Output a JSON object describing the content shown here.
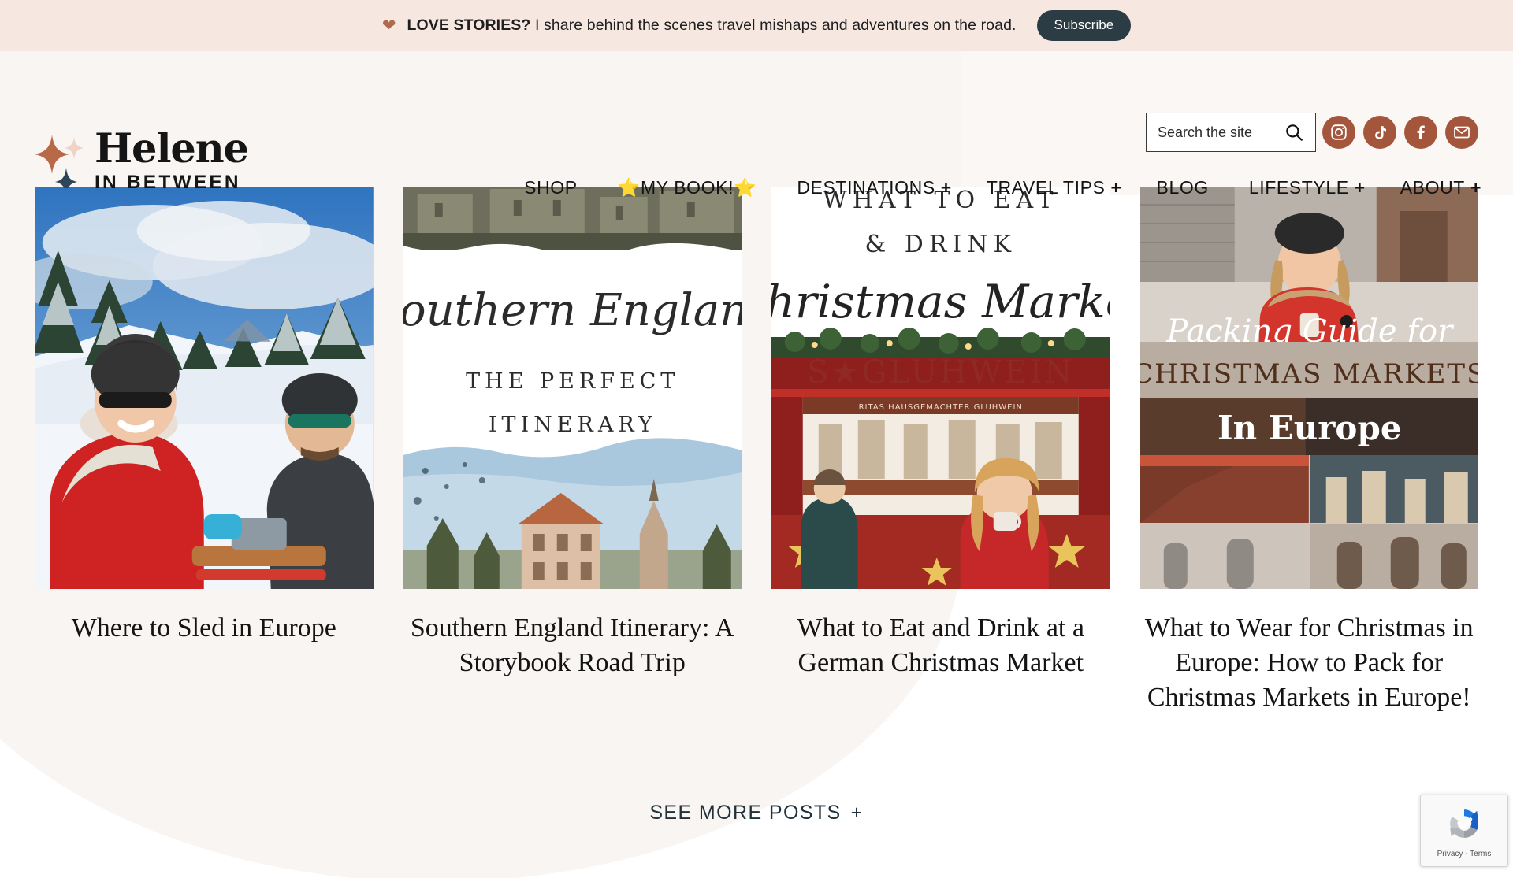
{
  "announcement": {
    "heart_icon": "heart-icon",
    "bold_text": "LOVE STORIES?",
    "rest_text": " I share behind the scenes travel mishaps and adventures on the road.",
    "subscribe_label": "Subscribe",
    "bg_color": "#f7e7e1",
    "button_color": "#2c3c44"
  },
  "header": {
    "logo": {
      "main": "Helene",
      "sub": "IN BETWEEN"
    },
    "search": {
      "placeholder": "Search the site",
      "value": "",
      "icon": "search-icon"
    },
    "socials": [
      {
        "name": "instagram-icon",
        "label": "Instagram"
      },
      {
        "name": "tiktok-icon",
        "label": "TikTok"
      },
      {
        "name": "facebook-icon",
        "label": "Facebook"
      },
      {
        "name": "email-icon",
        "label": "Email"
      }
    ],
    "social_color": "#a4563c",
    "nav": [
      {
        "label": "SHOP",
        "plus": ""
      },
      {
        "label": "⭐MY BOOK!⭐",
        "plus": ""
      },
      {
        "label": "DESTINATIONS",
        "plus": "+"
      },
      {
        "label": "TRAVEL TIPS",
        "plus": "+"
      },
      {
        "label": "BLOG",
        "plus": ""
      },
      {
        "label": "LIFESTYLE",
        "plus": "+"
      },
      {
        "label": "ABOUT",
        "plus": "+"
      }
    ]
  },
  "posts": [
    {
      "title": "Where to Sled in Europe",
      "image_alt": "Two people in ski gear smiling on a snowy alpine slope with snow covered pine trees and blue sky",
      "overlay_text": []
    },
    {
      "title": "Southern England Itinerary: A Storybook Road Trip",
      "image_alt": "Pinterest style graphic with castle above and town below",
      "overlay_text": [
        "Southern England",
        "THE PERFECT",
        "ITINERARY"
      ]
    },
    {
      "title": "What to Eat and Drink at a German Christmas Market",
      "image_alt": "Christmas market gluhwein stall graphic",
      "overlay_text": [
        "WHAT TO EAT",
        "& DRINK",
        "Christmas Market",
        "S GLUHWEIN"
      ]
    },
    {
      "title": "What to Wear for Christmas in Europe: How to Pack for Christmas Markets in Europe!",
      "image_alt": "Woman in red puffer coat at a Christmas market with packing guide text",
      "overlay_text": [
        "Packing Guide for",
        "CHRISTMAS MARKETS",
        "In Europe"
      ]
    }
  ],
  "see_more": {
    "label": "SEE MORE POSTS",
    "plus": "+"
  },
  "recaptcha": {
    "label": "Privacy - Terms",
    "icon": "recaptcha-icon"
  }
}
